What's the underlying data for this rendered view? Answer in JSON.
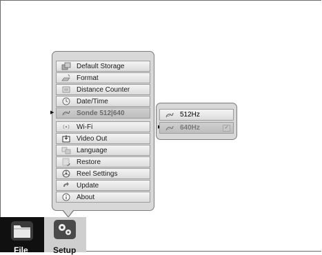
{
  "menu": {
    "items": [
      {
        "label": "Default Storage",
        "icon": "storage-icon"
      },
      {
        "label": "Format",
        "icon": "format-icon"
      },
      {
        "label": "Distance Counter",
        "icon": "distance-counter-icon"
      },
      {
        "label": "Date/Time",
        "icon": "clock-icon"
      },
      {
        "label": "Sonde 512|640",
        "icon": "sonde-icon"
      },
      {
        "label": "Wi-Fi",
        "icon": "wifi-icon"
      },
      {
        "label": "Video Out",
        "icon": "video-out-icon"
      },
      {
        "label": "Language",
        "icon": "language-icon"
      },
      {
        "label": "Restore",
        "icon": "restore-icon"
      },
      {
        "label": "Reel Settings",
        "icon": "reel-icon"
      },
      {
        "label": "Update",
        "icon": "update-icon"
      },
      {
        "label": "About",
        "icon": "info-icon"
      }
    ]
  },
  "submenu": {
    "items": [
      {
        "label": "512Hz",
        "icon": "sonde-icon"
      },
      {
        "label": "640Hz",
        "icon": "sonde-icon",
        "checked": true
      }
    ]
  },
  "dock": {
    "file_label": "File",
    "setup_label": "Setup"
  }
}
